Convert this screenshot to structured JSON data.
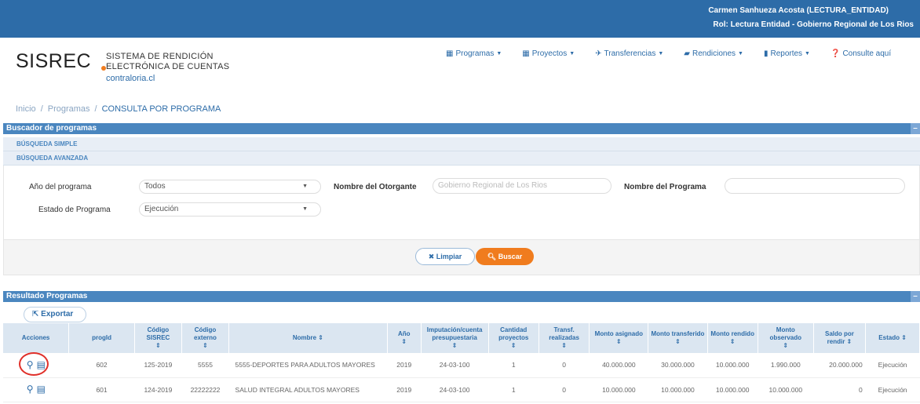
{
  "header": {
    "user": "Carmen Sanhueza Acosta (LECTURA_ENTIDAD)",
    "rol": "Rol: Lectura Entidad - Gobierno Regional de Los Rios"
  },
  "logo": {
    "name": "SISREC",
    "line1": "SISTEMA DE RENDICIÓN",
    "line2": "ELECTRÓNICA DE CUENTAS",
    "url": "contraloria.cl"
  },
  "nav": {
    "programas": "Programas",
    "proyectos": "Proyectos",
    "transferencias": "Transferencias",
    "rendiciones": "Rendiciones",
    "reportes": "Reportes",
    "consulte": "Consulte aquí"
  },
  "breadcrumb": [
    "Inicio",
    "/",
    "Programas",
    "/",
    "CONSULTA POR PROGRAMA"
  ],
  "buscador": {
    "title": "Buscador de programas",
    "tab_simple": "BÚSQUEDA SIMPLE",
    "tab_avanzada": "BÚSQUEDA AVANZADA",
    "anio_label": "Año del programa",
    "anio_value": "Todos",
    "otorgante_label": "Nombre del Otorgante",
    "otorgante_placeholder": "Gobierno Regional de Los Rios",
    "nombre_label": "Nombre del Programa",
    "estado_label": "Estado de Programa",
    "estado_value": "Ejecución",
    "limpiar": "Limpiar",
    "buscar": "Buscar"
  },
  "resultado": {
    "title": "Resultado Programas",
    "exportar": "Exportar",
    "columns": [
      "Acciones",
      "progId",
      "Código SISREC",
      "Código externo",
      "Nombre",
      "Año",
      "Imputación/cuenta presupuestaria",
      "Cantidad proyectos",
      "Transf. realizadas",
      "Monto asignado",
      "Monto transferido",
      "Monto rendido",
      "Monto observado",
      "Saldo por rendir",
      "Estado"
    ],
    "rows": [
      {
        "progId": "602",
        "sisrec": "125-2019",
        "externo": "5555",
        "nombre": "5555-DEPORTES PARA ADULTOS MAYORES",
        "anio": "2019",
        "imputacion": "24-03-100",
        "proyectos": "1",
        "transf": "0",
        "asignado": "40.000.000",
        "transferido": "30.000.000",
        "rendido": "10.000.000",
        "observado": "1.990.000",
        "saldo": "20.000.000",
        "estado": "Ejecución"
      },
      {
        "progId": "601",
        "sisrec": "124-2019",
        "externo": "22222222",
        "nombre": "SALUD INTEGRAL ADULTOS MAYORES",
        "anio": "2019",
        "imputacion": "24-03-100",
        "proyectos": "1",
        "transf": "0",
        "asignado": "10.000.000",
        "transferido": "10.000.000",
        "rendido": "10.000.000",
        "observado": "10.000.000",
        "saldo": "0",
        "estado": "Ejecución"
      }
    ]
  },
  "colors": {
    "primary": "#2d6ca8",
    "accent": "#f07c1e",
    "header_bar": "#4a86bf"
  }
}
